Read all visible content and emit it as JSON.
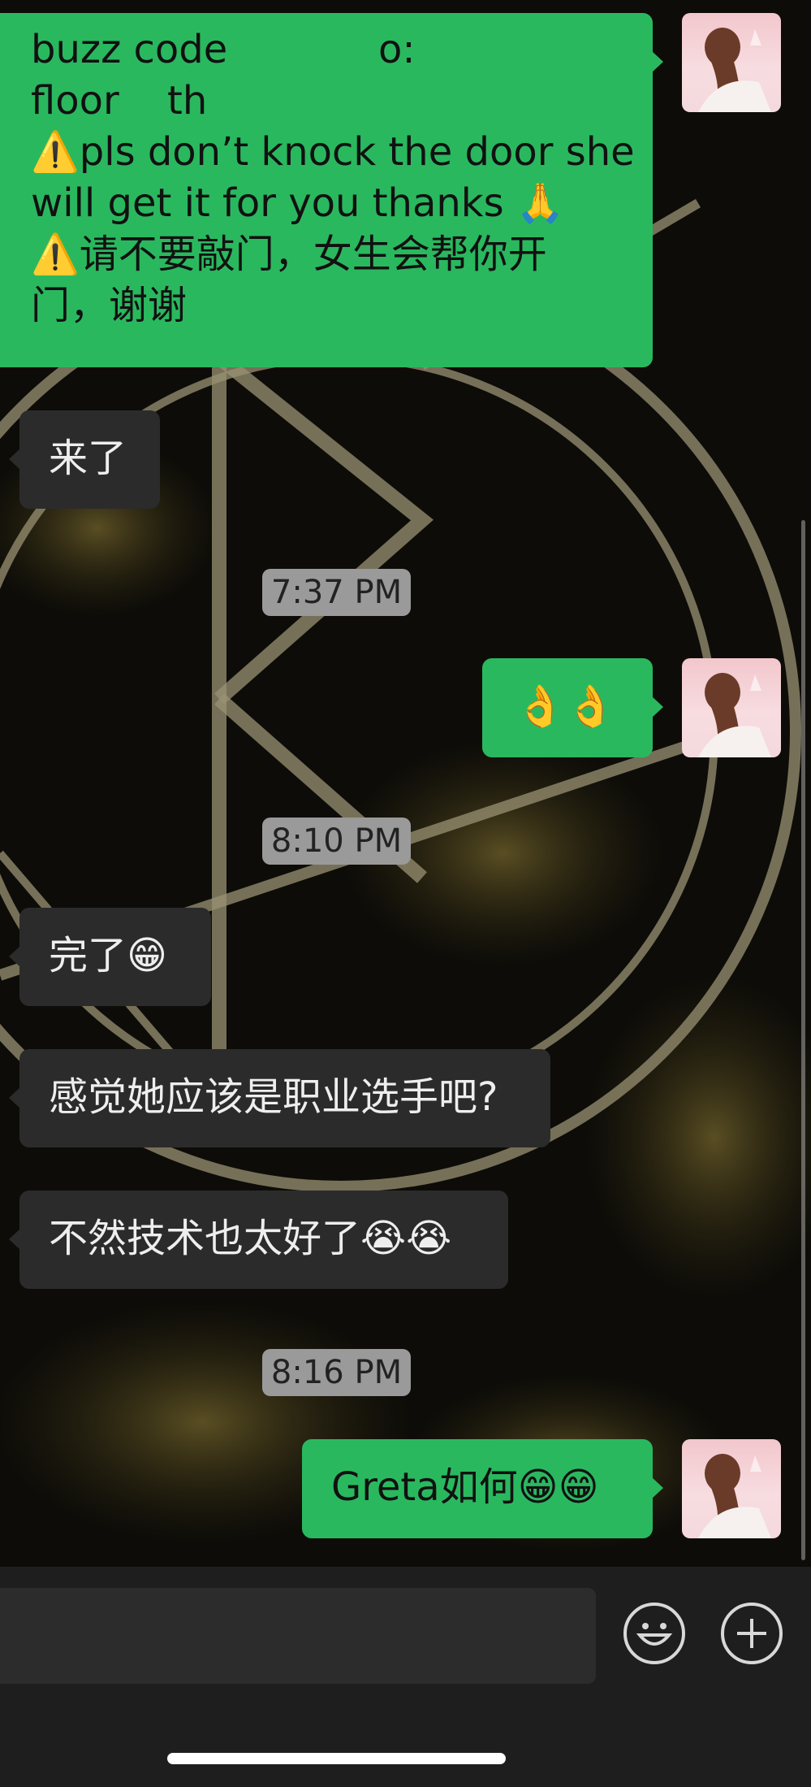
{
  "messages": {
    "m1_line1": "buzz code",
    "m1_line1_end": "o:",
    "m1_line2": "floor",
    "m1_line2_end": "th",
    "m1_line3": "⚠️pls don’t knock the door she",
    "m1_line4": "will get it for you thanks 🙏",
    "m1_line5": "⚠️请不要敲门，女生会帮你开",
    "m1_line6": "门，谢谢",
    "m2": "来了",
    "m3": "👌👌",
    "m4": "完了😁",
    "m5": "感觉她应该是职业选手吧?",
    "m6": "不然技术也太好了😭😭",
    "m7": "Greta如何😁😁"
  },
  "timestamps": {
    "t1": "7:37 PM",
    "t2": "8:10 PM",
    "t3": "8:16 PM"
  },
  "input": {
    "value": ""
  },
  "icons": {
    "emoji_button": "smiley-icon",
    "more_button": "plus-circle-icon"
  },
  "colors": {
    "outgoing_bubble": "#2ab85f",
    "incoming_bubble": "#2b2b2b",
    "timestamp_bg": "#9a9a9a",
    "input_bar": "#1e1e1e"
  }
}
